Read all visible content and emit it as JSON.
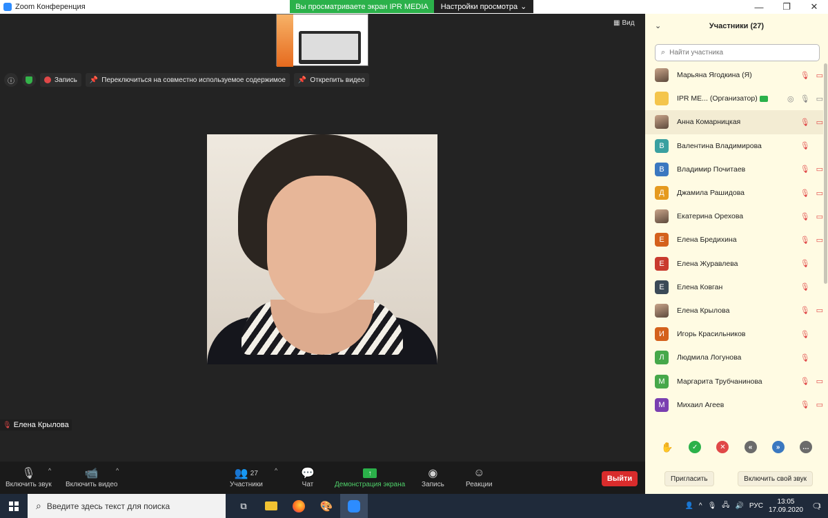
{
  "window": {
    "title": "Zoom Конференция",
    "share_banner": "Вы просматриваете экран IPR MEDIA",
    "view_settings": "Настройки просмотра",
    "view_label": "Вид"
  },
  "overlay": {
    "record_label": "Запись",
    "switch_label": "Переключиться на совместно используемое содержимое",
    "unpin_label": "Открепить видео"
  },
  "video": {
    "name": "Елена Крылова"
  },
  "toolbar": {
    "mute_label": "Включить звук",
    "video_label": "Включить видео",
    "participants_label": "Участники",
    "participants_count": "27",
    "chat_label": "Чат",
    "share_label": "Демонстрация экрана",
    "record_label": "Запись",
    "reactions_label": "Реакции",
    "leave_label": "Выйти"
  },
  "panel": {
    "title": "Участники (27)",
    "search_placeholder": "Найти участника",
    "participants": [
      {
        "name": "Марьяна Ягодкина (Я)",
        "avatar": "photo",
        "initial": "",
        "color": "",
        "mic": "off",
        "cam": "off"
      },
      {
        "name": "IPR ME...   (Организатор)",
        "avatar": "laptop",
        "initial": "",
        "color": "",
        "mic": "on",
        "cam": "on",
        "host": true
      },
      {
        "name": "Анна Комарницкая",
        "avatar": "photo",
        "initial": "",
        "color": "",
        "mic": "off",
        "cam": "off"
      },
      {
        "name": "Валентина Владимирова",
        "avatar": "letter",
        "initial": "В",
        "color": "#3aa0a0",
        "mic": "off",
        "cam": "none"
      },
      {
        "name": "Владимир Почитаев",
        "avatar": "letter",
        "initial": "В",
        "color": "#3a78c0",
        "mic": "off",
        "cam": "off"
      },
      {
        "name": "Джамила Рашидова",
        "avatar": "letter",
        "initial": "Д",
        "color": "#e59a1e",
        "mic": "off",
        "cam": "off"
      },
      {
        "name": "Екатерина Орехова",
        "avatar": "photo",
        "initial": "",
        "color": "",
        "mic": "off",
        "cam": "off"
      },
      {
        "name": "Елена Бредихина",
        "avatar": "letter",
        "initial": "Е",
        "color": "#d4611c",
        "mic": "off",
        "cam": "off"
      },
      {
        "name": "Елена Журавлева",
        "avatar": "letter",
        "initial": "Е",
        "color": "#c93a2e",
        "mic": "off",
        "cam": "none"
      },
      {
        "name": "Елена Ковган",
        "avatar": "letter",
        "initial": "Е",
        "color": "#3b4a57",
        "mic": "off",
        "cam": "none"
      },
      {
        "name": "Елена Крылова",
        "avatar": "photo",
        "initial": "",
        "color": "",
        "mic": "off",
        "cam": "off"
      },
      {
        "name": "Игорь Красильников",
        "avatar": "letter",
        "initial": "И",
        "color": "#d4611c",
        "mic": "off",
        "cam": "none"
      },
      {
        "name": "Людмила Логунова",
        "avatar": "letter",
        "initial": "Л",
        "color": "#46a84a",
        "mic": "off",
        "cam": "none"
      },
      {
        "name": "Маргарита Трубчанинова",
        "avatar": "letter",
        "initial": "М",
        "color": "#46a84a",
        "mic": "off",
        "cam": "off"
      },
      {
        "name": "Михаил Агеев",
        "avatar": "letter",
        "initial": "М",
        "color": "#7a3fb0",
        "mic": "off",
        "cam": "off"
      }
    ],
    "invite_label": "Пригласить",
    "unmute_label": "Включить свой звук"
  },
  "taskbar": {
    "search_placeholder": "Введите здесь текст для поиска",
    "lang": "РУС",
    "time": "13:05",
    "date": "17.09.2020",
    "notif_count": "1"
  },
  "colors": {
    "share_green": "#2bb14a",
    "leave_red": "#d92c2c",
    "panel_bg": "#fffbe3"
  }
}
